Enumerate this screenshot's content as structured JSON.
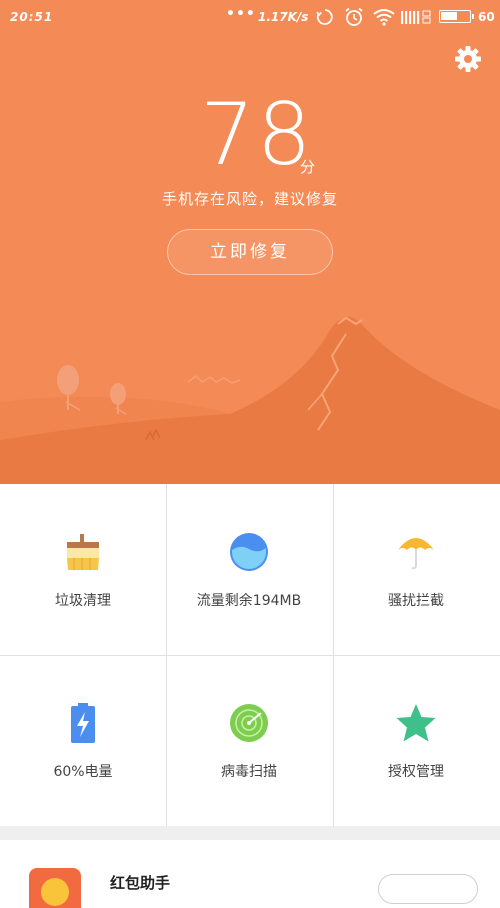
{
  "status_bar": {
    "time": "20:51",
    "dots": "•••",
    "network_speed": "1.17K/s",
    "battery_percent": "60",
    "battery_level": 0.6
  },
  "header": {
    "settings_icon": "gear-icon",
    "score": "78",
    "score_unit": "分",
    "risk_text": "手机存在风险，建议修复",
    "fix_button": "立即修复"
  },
  "tools": [
    {
      "label": "垃圾清理",
      "icon": "broom-icon"
    },
    {
      "label": "流量剩余194MB",
      "icon": "water-gauge-icon"
    },
    {
      "label": "骚扰拦截",
      "icon": "umbrella-icon"
    },
    {
      "label": "60%电量",
      "icon": "battery-bolt-icon"
    },
    {
      "label": "病毒扫描",
      "icon": "radar-icon"
    },
    {
      "label": "授权管理",
      "icon": "star-icon"
    }
  ],
  "promo": {
    "title": "红包助手",
    "icon": "red-envelope-icon"
  },
  "colors": {
    "hero_orange": "#f48a55",
    "mountain": "#ea7a43",
    "water_blue": "#4a8ef0",
    "umbrella": "#f7b733",
    "radar_green": "#7dcd4e",
    "star_green": "#3fbf8a"
  }
}
